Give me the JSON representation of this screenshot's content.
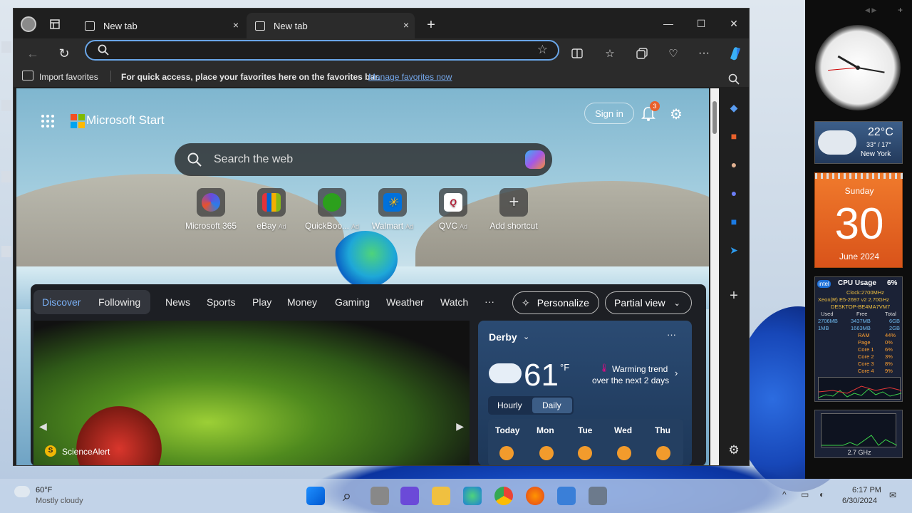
{
  "browser": {
    "tabs": [
      {
        "label": "New tab",
        "active": false
      },
      {
        "label": "New tab",
        "active": true
      }
    ],
    "new_tab_symbol": "+",
    "close_symbol": "×",
    "window_controls": {
      "minimize": "—",
      "maximize": "☐",
      "close": "✕"
    },
    "address_bar": {
      "value": "",
      "placeholder": ""
    },
    "toolbar_icons": [
      "back-icon",
      "refresh-icon",
      "favorite-star-icon",
      "split-screen-icon",
      "favorites-icon",
      "collections-icon",
      "browser-essentials-icon",
      "more-icon",
      "copilot-icon"
    ],
    "favorites_bar": {
      "import_label": "Import favorites",
      "message": "For quick access, place your favorites here on the favorites bar.",
      "manage_link": "Manage favorites now"
    }
  },
  "newtab": {
    "brand": "Microsoft Start",
    "sign_in": "Sign in",
    "notification_count": "3",
    "search_placeholder": "Search the web",
    "shortcuts": [
      {
        "label": "Microsoft 365",
        "ad": "",
        "color": "#6b4ad8"
      },
      {
        "label": "eBay",
        "ad": "Ad",
        "color": "#e53238"
      },
      {
        "label": "QuickBoo...",
        "ad": "Ad",
        "color": "#2ca01c"
      },
      {
        "label": "Walmart",
        "ad": "Ad",
        "color": "#0071dc"
      },
      {
        "label": "QVC",
        "ad": "Ad",
        "color": "#ffffff"
      },
      {
        "label": "Add shortcut",
        "ad": "",
        "color": "#555555"
      }
    ],
    "feed_nav": {
      "discover": "Discover",
      "following": "Following",
      "items": [
        "News",
        "Sports",
        "Play",
        "Money",
        "Gaming",
        "Weather",
        "Watch"
      ],
      "more": "···",
      "personalize": "Personalize",
      "partial_view": "Partial view"
    },
    "hero": {
      "source": "ScienceAlert"
    },
    "weather": {
      "location": "Derby",
      "temp": "61",
      "unit": "°F",
      "trend_line1": "Warming trend",
      "trend_line2": "over the next 2 days",
      "tabs": [
        "Hourly",
        "Daily"
      ],
      "days": [
        "Today",
        "Mon",
        "Tue",
        "Wed",
        "Thu"
      ]
    }
  },
  "gadgets": {
    "weather": {
      "temp": "22°C",
      "range": "33° / 17°",
      "city": "New York"
    },
    "calendar": {
      "weekday": "Sunday",
      "day": "30",
      "month_year": "June 2024"
    },
    "cpu": {
      "title": "CPU Usage",
      "percent": "6%",
      "clock": "Clock:2700MHz",
      "model": "Xeon(R) E5-2697 v2 2.70GHz",
      "host": "DESKTOP-BE4MA7VM7",
      "headers": [
        "Used",
        "Free",
        "Total"
      ],
      "row1": [
        "2706MB",
        "3437MB",
        "6GB"
      ],
      "row2": [
        "1MB",
        "1663MB",
        "2GB"
      ],
      "stats": [
        {
          "name": "RAM",
          "val": "44%"
        },
        {
          "name": "Page",
          "val": "0%"
        },
        {
          "name": "Core 1",
          "val": "6%"
        },
        {
          "name": "Core 2",
          "val": "3%"
        },
        {
          "name": "Core 3",
          "val": "8%"
        },
        {
          "name": "Core 4",
          "val": "9%"
        }
      ]
    },
    "freq": "2.7 GHz"
  },
  "taskbar": {
    "weather_temp": "60°F",
    "weather_desc": "Mostly cloudy",
    "time": "6:17 PM",
    "date": "6/30/2024"
  }
}
